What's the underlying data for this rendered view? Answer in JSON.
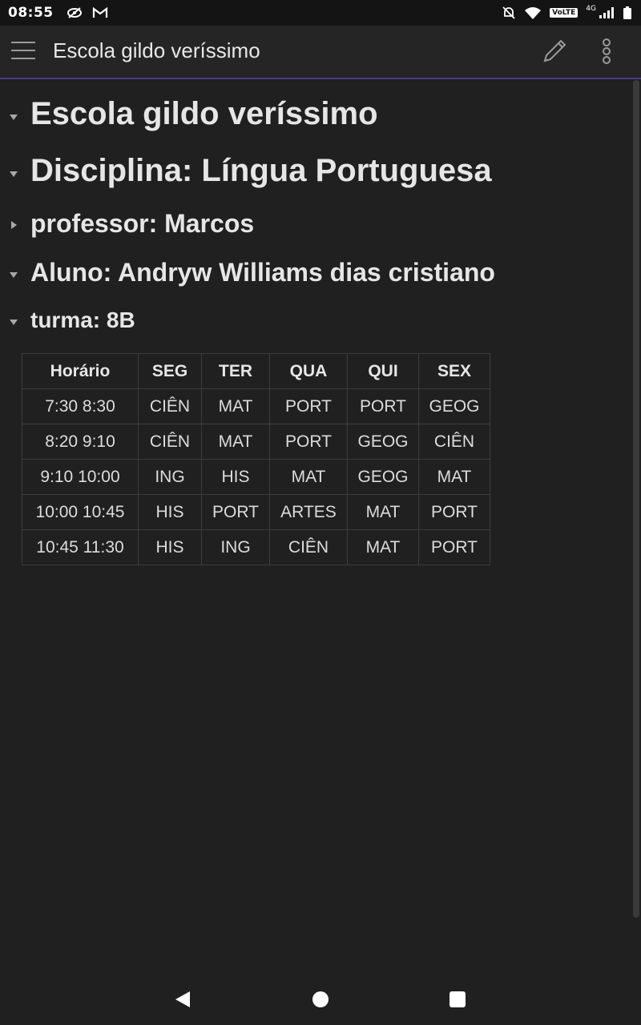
{
  "status_bar": {
    "time": "08:55",
    "volte": "VoLTE",
    "network": "4G"
  },
  "app_bar": {
    "title": "Escola gildo veríssimo",
    "icons": [
      "menu-icon",
      "pencil-icon",
      "more-vert-icon"
    ]
  },
  "document": {
    "headings": [
      {
        "text": "Escola gildo veríssimo",
        "collapsed": false
      },
      {
        "text": "Disciplina: Língua Portuguesa",
        "collapsed": false
      },
      {
        "text": "professor: Marcos",
        "collapsed": true
      },
      {
        "text": "Aluno: Andryw Williams dias cristiano",
        "collapsed": false
      },
      {
        "text": "turma: 8B",
        "collapsed": false
      }
    ],
    "table": {
      "headers": [
        "Horário",
        "SEG",
        "TER",
        "QUA",
        "QUI",
        "SEX"
      ],
      "rows": [
        [
          "7:30 8:30",
          "CIÊN",
          "MAT",
          "PORT",
          "PORT",
          "GEOG"
        ],
        [
          "8:20 9:10",
          "CIÊN",
          "MAT",
          "PORT",
          "GEOG",
          "CIÊN"
        ],
        [
          "9:10 10:00",
          "ING",
          "HIS",
          "MAT",
          "GEOG",
          "MAT"
        ],
        [
          "10:00 10:45",
          "HIS",
          "PORT",
          "ARTES",
          "MAT",
          "PORT"
        ],
        [
          "10:45 11:30",
          "HIS",
          "ING",
          "CIÊN",
          "MAT",
          "PORT"
        ]
      ]
    }
  }
}
